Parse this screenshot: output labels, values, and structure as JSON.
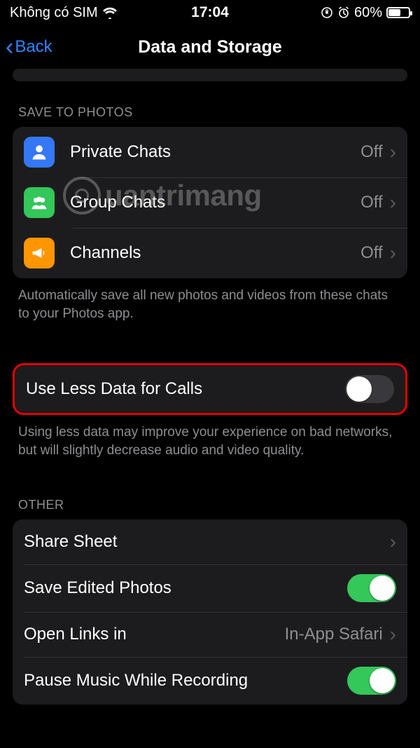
{
  "status": {
    "carrier": "Không có SIM",
    "time": "17:04",
    "battery_pct": "60%"
  },
  "nav": {
    "back_label": "Back",
    "title": "Data and Storage"
  },
  "save_to_photos": {
    "header": "SAVE TO PHOTOS",
    "rows": {
      "private": {
        "label": "Private Chats",
        "value": "Off"
      },
      "group": {
        "label": "Group Chats",
        "value": "Off"
      },
      "channels": {
        "label": "Channels",
        "value": "Off"
      }
    },
    "footer": "Automatically save all new photos and videos from these chats to your Photos app."
  },
  "calls": {
    "label": "Use Less Data for Calls",
    "footer": "Using less data may improve your experience on bad networks, but will slightly decrease audio and video quality."
  },
  "other": {
    "header": "OTHER",
    "share_sheet": {
      "label": "Share Sheet"
    },
    "save_edited": {
      "label": "Save Edited Photos"
    },
    "open_links": {
      "label": "Open Links in",
      "value": "In-App Safari"
    },
    "pause_music": {
      "label": "Pause Music While Recording"
    }
  },
  "watermark": "uantrimang"
}
